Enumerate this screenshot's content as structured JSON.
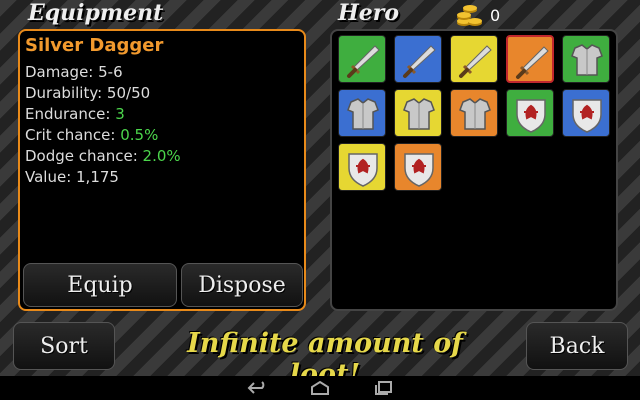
{
  "header": {
    "equipment_title": "Equipment",
    "hero_title": "Hero",
    "gold": "0",
    "gold_icon": "gold-coins-icon"
  },
  "item": {
    "name": "Silver Dagger",
    "damage_label": "Damage: 5-6",
    "durability_label": "Durability: 50/50",
    "endurance_label": "Endurance: ",
    "endurance_value": "3",
    "crit_label": "Crit chance: ",
    "crit_value": "0.5%",
    "dodge_label": "Dodge chance: ",
    "dodge_value": "2.0%",
    "value_label": "Value: 1,175"
  },
  "buttons": {
    "equip": "Equip",
    "dispose": "Dispose",
    "sort": "Sort",
    "back": "Back"
  },
  "promo": "Infinite amount of loot!",
  "inventory": [
    {
      "type": "sword",
      "bg": "#3fae3f",
      "selected": false
    },
    {
      "type": "sword",
      "bg": "#3b6fd1",
      "selected": false
    },
    {
      "type": "sword",
      "bg": "#e6d732",
      "selected": false
    },
    {
      "type": "sword",
      "bg": "#e8862c",
      "selected": true
    },
    {
      "type": "armor",
      "bg": "#3fae3f",
      "selected": false
    },
    {
      "type": "armor",
      "bg": "#3b6fd1",
      "selected": false
    },
    {
      "type": "armor",
      "bg": "#e6d732",
      "selected": false
    },
    {
      "type": "armor",
      "bg": "#e8862c",
      "selected": false
    },
    {
      "type": "shield",
      "bg": "#3fae3f",
      "selected": false
    },
    {
      "type": "shield",
      "bg": "#3b6fd1",
      "selected": false
    },
    {
      "type": "shield",
      "bg": "#e6d732",
      "selected": false
    },
    {
      "type": "shield",
      "bg": "#e8862c",
      "selected": false
    }
  ],
  "colors": {
    "accent": "#e88a1a",
    "item_name": "#f29a2e",
    "stat_value": "#4cd64c",
    "promo": "#e6d84a"
  },
  "navbar": {
    "icons": [
      "back-nav-icon",
      "home-nav-icon",
      "recents-nav-icon"
    ]
  }
}
